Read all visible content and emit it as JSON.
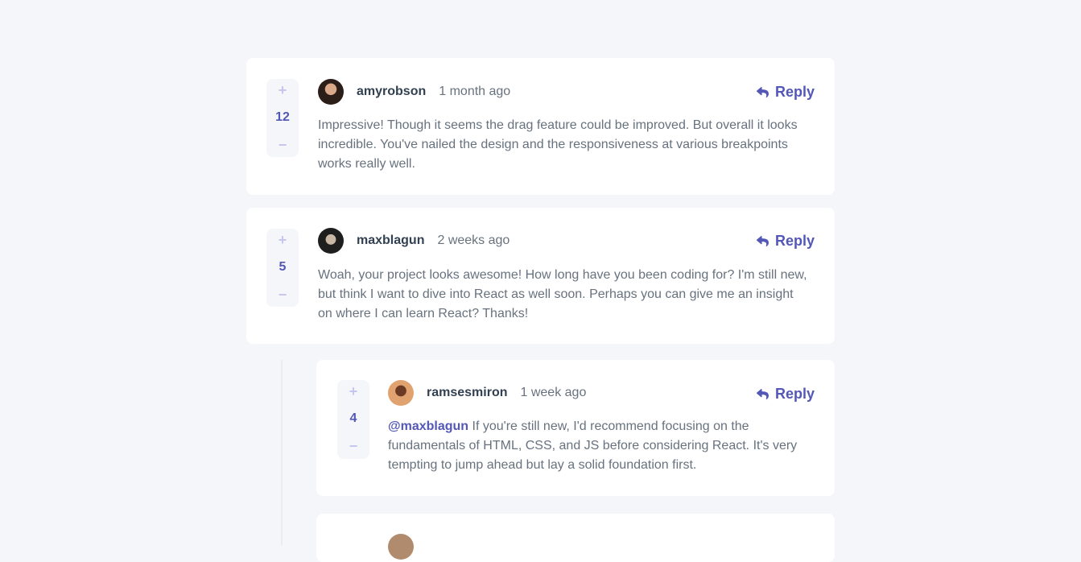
{
  "comments": [
    {
      "score": "12",
      "username": "amyrobson",
      "created": "1 month ago",
      "reply_label": "Reply",
      "content": "Impressive! Though it seems the drag feature could be improved. But overall it looks incredible. You've nailed the design and the responsiveness at various breakpoints works really well.",
      "plus": "+",
      "minus": "−"
    },
    {
      "score": "5",
      "username": "maxblagun",
      "created": "2 weeks ago",
      "reply_label": "Reply",
      "content": "Woah, your project looks awesome! How long have you been coding for? I'm still new, but think I want to dive into React as well soon. Perhaps you can give me an insight on where I can learn React? Thanks!",
      "plus": "+",
      "minus": "−"
    },
    {
      "score": "4",
      "username": "ramsesmiron",
      "created": "1 week ago",
      "reply_label": "Reply",
      "mention": "@maxblagun",
      "content": " If you're still new, I'd recommend focusing on the fundamentals of HTML, CSS, and JS before considering React. It's very tempting to jump ahead but lay a solid foundation first.",
      "plus": "+",
      "minus": "−"
    }
  ],
  "colors": {
    "background": "#f5f6fa",
    "card": "#ffffff",
    "accent": "#5357b6",
    "vote_icon": "#c5c6ef",
    "text": "#67727e",
    "username": "#324152"
  },
  "icons": {
    "reply": "reply-icon",
    "upvote": "plus-icon",
    "downvote": "minus-icon"
  }
}
